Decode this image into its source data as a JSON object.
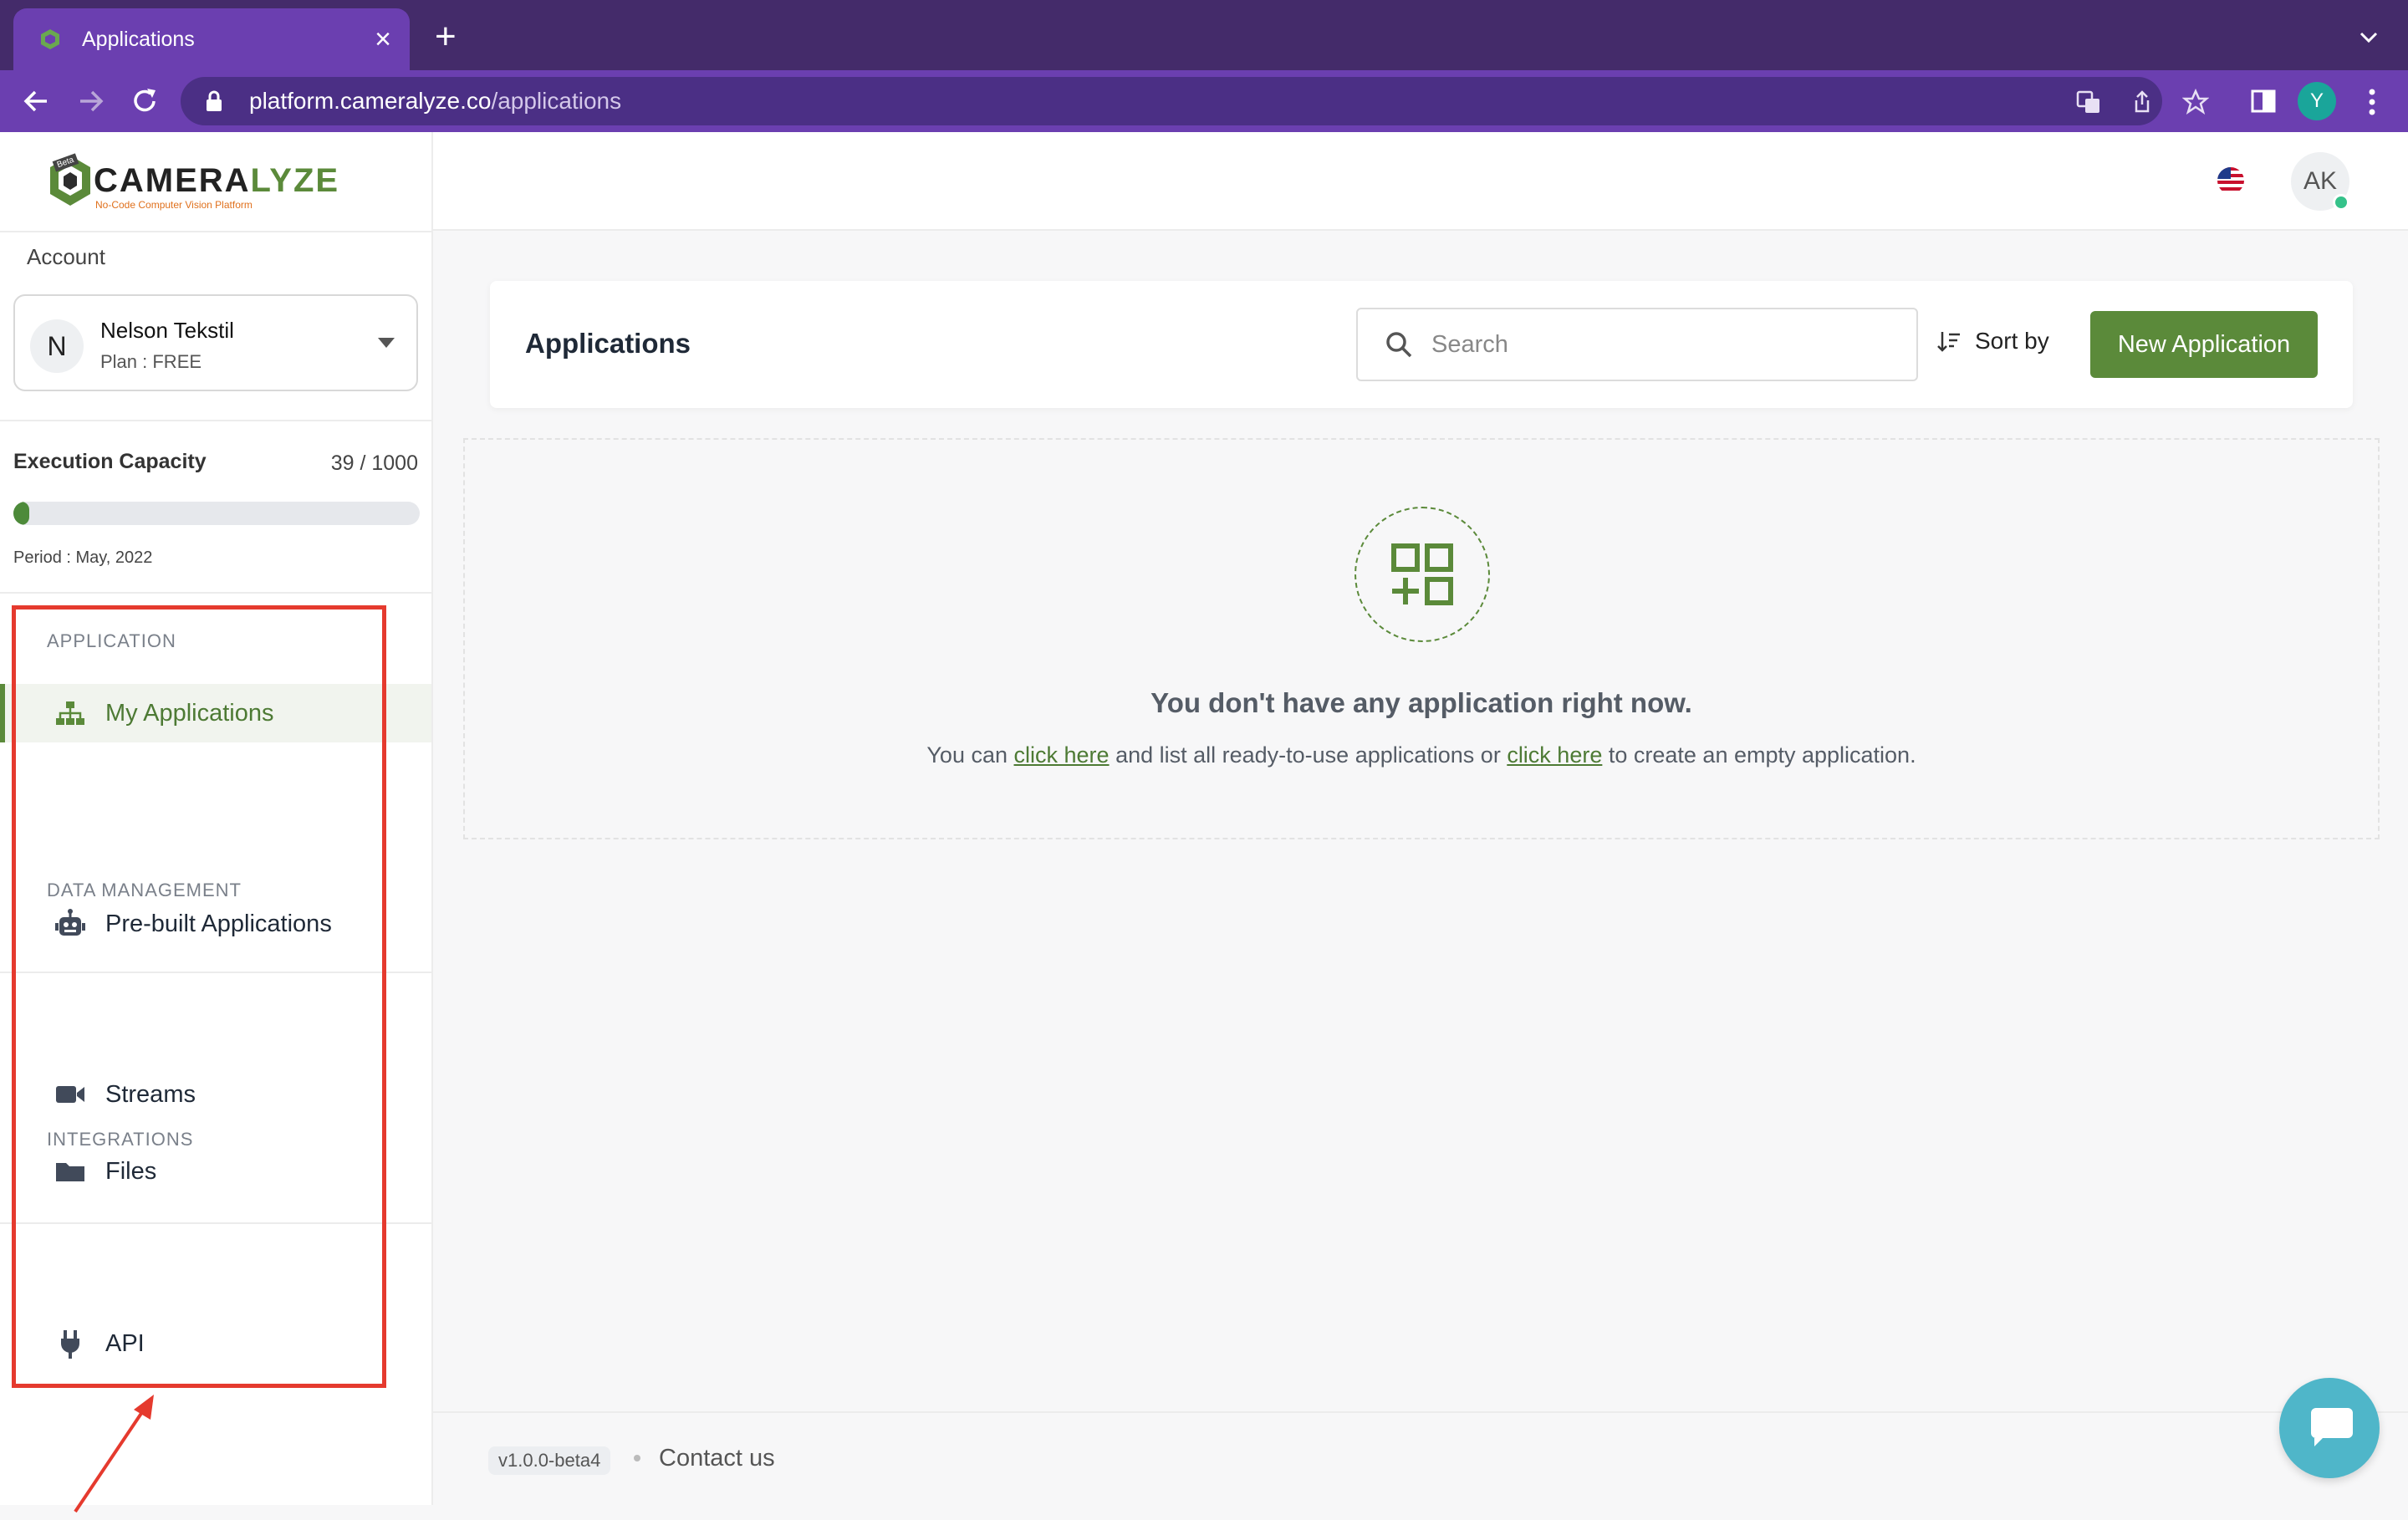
{
  "browser": {
    "tab_title": "Applications",
    "url_host": "platform.cameralyze.co",
    "url_path": "/applications",
    "profile_initial": "Y"
  },
  "logo": {
    "name_main": "CAMERA",
    "name_accent": "LYZE",
    "tagline": "No-Code Computer Vision Platform",
    "badge": "Beta"
  },
  "account": {
    "label": "Account",
    "avatar_initial": "N",
    "name": "Nelson Tekstil",
    "plan": "Plan : FREE"
  },
  "capacity": {
    "label": "Execution Capacity",
    "value_text": "39 / 1000",
    "used": 39,
    "total": 1000,
    "period": "Period : May, 2022"
  },
  "sidebar": {
    "sections": [
      {
        "label": "APPLICATION",
        "items": [
          {
            "label": "My Applications",
            "icon": "sitemap-icon",
            "active": true
          },
          {
            "label": "Pre-built Applications",
            "icon": "robot-icon",
            "active": false
          }
        ]
      },
      {
        "label": "DATA MANAGEMENT",
        "items": [
          {
            "label": "Streams",
            "icon": "video-camera-icon",
            "active": false
          },
          {
            "label": "Files",
            "icon": "folder-icon",
            "active": false
          }
        ]
      },
      {
        "label": "INTEGRATIONS",
        "items": [
          {
            "label": "API",
            "icon": "plug-icon",
            "active": false
          }
        ]
      }
    ]
  },
  "header": {
    "user_initials": "AK",
    "language_flag": "us-flag-icon"
  },
  "main": {
    "title": "Applications",
    "search_placeholder": "Search",
    "sort_label": "Sort by",
    "new_button": "New Application",
    "empty": {
      "title": "You don't have any application right now.",
      "text_1": "You can ",
      "link_1": "click here",
      "text_2": " and list all ready-to-use applications or ",
      "link_2": "click here",
      "text_3": " to create an empty application."
    }
  },
  "footer": {
    "version": "v1.0.0-beta4",
    "contact": "Contact us"
  },
  "colors": {
    "brand_green": "#5b8a3a",
    "browser_purple": "#6b3fb0",
    "annotation_red": "#e53a2e",
    "chat_teal": "#4fb6c9"
  }
}
